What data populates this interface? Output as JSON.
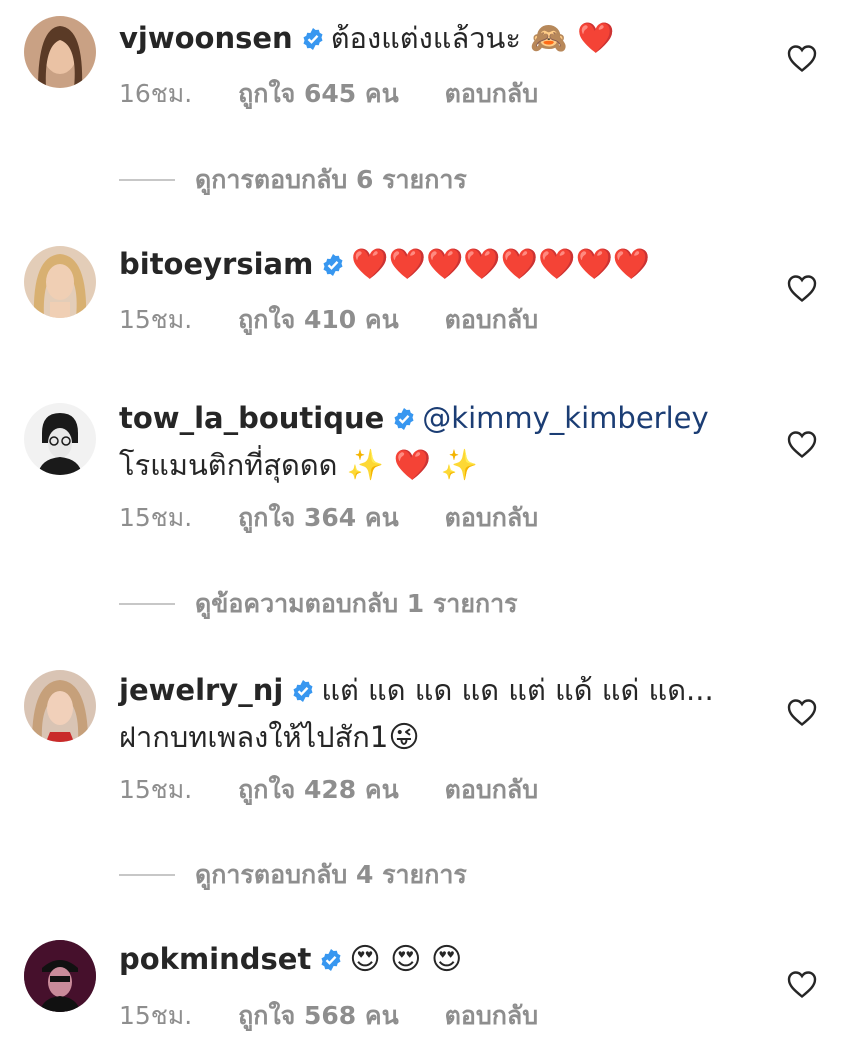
{
  "comments": [
    {
      "username": "vjwoonsen",
      "verified": true,
      "text_line1": "ต้องแต่งแล้วนะ",
      "emoji_line1": "🙈 ❤️",
      "time": "16ชม.",
      "likes": "ถูกใจ 645 คน",
      "reply": "ตอบกลับ",
      "replies_link": "ดูการตอบกลับ 6 รายการ"
    },
    {
      "username": "bitoeyrsiam",
      "verified": true,
      "emoji_line1": "❤️❤️❤️❤️❤️❤️❤️❤️",
      "time": "15ชม.",
      "likes": "ถูกใจ 410 คน",
      "reply": "ตอบกลับ"
    },
    {
      "username": "tow_la_boutique",
      "verified": true,
      "mention": "@kimmy_kimberley",
      "text_line2": "โรแมนติกที่สุดดด",
      "emoji_line2": "✨ ❤️ ✨",
      "time": "15ชม.",
      "likes": "ถูกใจ 364 คน",
      "reply": "ตอบกลับ",
      "replies_link": "ดูข้อความตอบกลับ 1 รายการ"
    },
    {
      "username": "jewelry_nj",
      "verified": true,
      "text_line1": "แต่ แด แด แด แต่ แด้ แด่ แด...",
      "text_line2": "ฝากบทเพลงให้ไปสัก1",
      "emoji_line2": "😜",
      "time": "15ชม.",
      "likes": "ถูกใจ 428 คน",
      "reply": "ตอบกลับ",
      "replies_link": "ดูการตอบกลับ 4 รายการ"
    },
    {
      "username": "pokmindset",
      "verified": true,
      "emoji_line1": "😍 😍 😍",
      "time": "15ชม.",
      "likes": "ถูกใจ 568 คน",
      "reply": "ตอบกลับ"
    }
  ],
  "icons": {
    "verified": "verified-badge-icon",
    "like": "heart-outline-icon"
  },
  "colors": {
    "verified_blue": "#3897f0",
    "mention": "#1b3d74",
    "meta_gray": "#8e8e8e",
    "heart_red": "#ed4956"
  }
}
